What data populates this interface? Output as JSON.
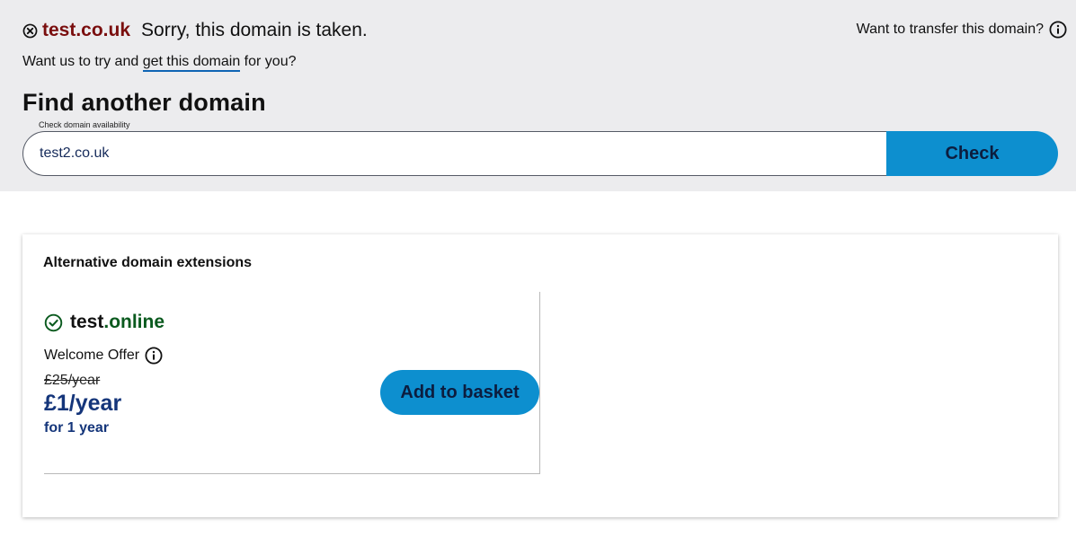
{
  "header": {
    "taken_domain": "test.co.uk",
    "taken_message": "Sorry, this domain is taken.",
    "transfer_text": "Want to transfer this domain?",
    "try_prefix": "Want us to try and",
    "try_link": "get this domain",
    "try_suffix": "for you?"
  },
  "search": {
    "title": "Find another domain",
    "label": "Check domain availability",
    "value": "test2.co.uk",
    "button_label": "Check"
  },
  "alternatives": {
    "title": "Alternative domain extensions",
    "offers": [
      {
        "name": "test",
        "tld": ".online",
        "offer_label": "Welcome Offer",
        "old_price": "£25/year",
        "price": "£1/year",
        "term": "for 1 year",
        "button_label": "Add to basket"
      }
    ]
  },
  "colors": {
    "accent": "#0d8fcf",
    "taken": "#7a0e0e",
    "available": "#0a5a1e",
    "price": "#14357a"
  }
}
